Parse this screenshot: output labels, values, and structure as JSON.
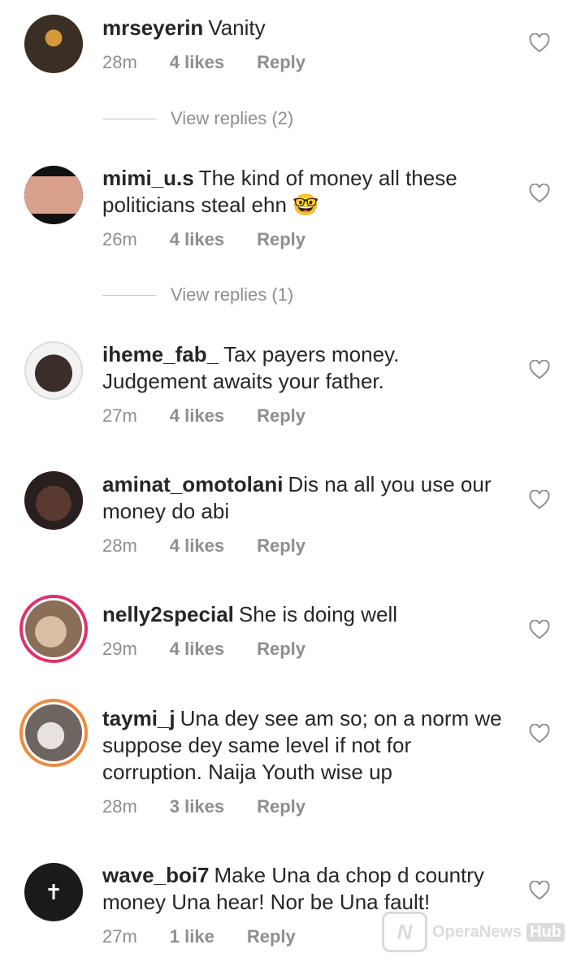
{
  "comments": [
    {
      "username": "mrseyerin",
      "text": "Vanity",
      "time": "28m",
      "likes": "4 likes",
      "reply": "Reply",
      "avatar_color": "#5a4a3a",
      "view_replies": "View replies (2)"
    },
    {
      "username": "mimi_u.s",
      "text": "The kind of money all these politicians steal ehn 🤓",
      "time": "26m",
      "likes": "4 likes",
      "reply": "Reply",
      "avatar_color": "#c98b7a",
      "view_replies": "View replies (1)"
    },
    {
      "username": "iheme_fab_",
      "text": "Tax payers money. Judgement awaits your father.",
      "time": "27m",
      "likes": "4 likes",
      "reply": "Reply",
      "avatar_color": "#3b2e2a"
    },
    {
      "username": "aminat_omotolani",
      "text": "Dis na all you use our money do abi",
      "time": "28m",
      "likes": "4 likes",
      "reply": "Reply",
      "avatar_color": "#4a3030"
    },
    {
      "username": "nelly2special",
      "text": "She is doing well",
      "time": "29m",
      "likes": "4 likes",
      "reply": "Reply",
      "avatar_color": "#b59a82"
    },
    {
      "username": "taymi_j",
      "text": "Una dey see am so; on a norm we suppose dey same level if not for corruption. Naija Youth wise up",
      "time": "28m",
      "likes": "3 likes",
      "reply": "Reply",
      "avatar_color": "#9a8f88"
    },
    {
      "username": "wave_boi7",
      "text": "Make Una da chop d country money Una hear! Nor be Una fault!",
      "time": "27m",
      "likes": "1 like",
      "reply": "Reply",
      "avatar_color": "#1a1a1a",
      "avatar_glyph": "✝"
    }
  ],
  "watermark": {
    "brand": "OperaNews",
    "hub": "Hub",
    "logo_letter": "N"
  },
  "colors": {
    "meta": "#8e8e8e",
    "ring": "#e1306c"
  }
}
